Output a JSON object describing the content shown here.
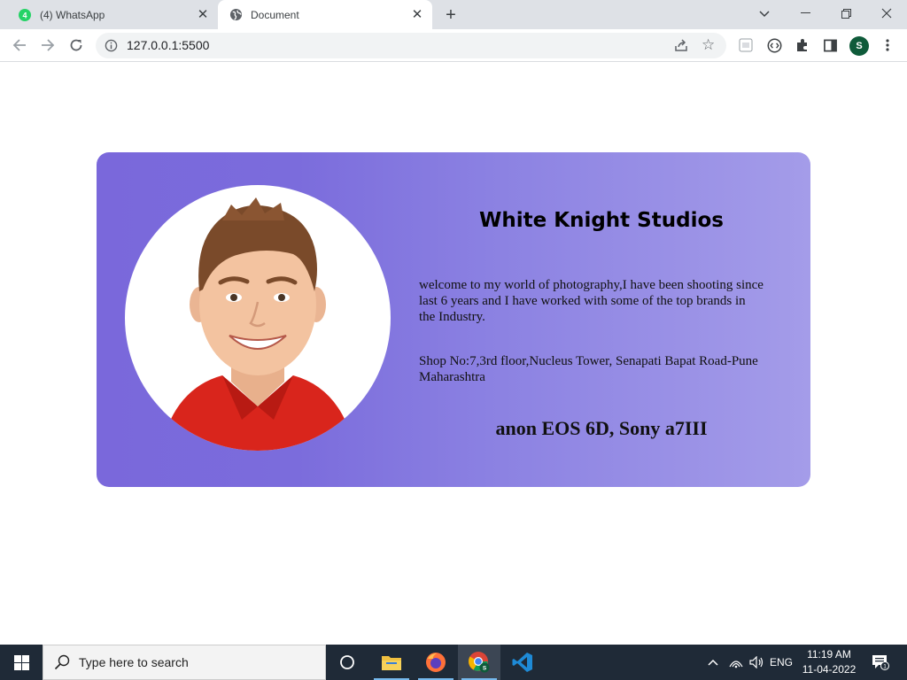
{
  "browser": {
    "tabs": [
      {
        "title": "(4) WhatsApp",
        "icon": "whatsapp-icon",
        "badge": "4",
        "active": false
      },
      {
        "title": "Document",
        "icon": "globe-icon",
        "active": true
      }
    ],
    "url": "127.0.0.1:5500",
    "profile_initial": "S"
  },
  "page": {
    "studio_name": "White Knight Studios",
    "description": "welcome to my world of photography,I have been shooting since last 6 years and I have worked with some of the top brands in the Industry.",
    "address": "Shop No:7,3rd floor,Nucleus Tower, Senapati Bapat Road-Pune Maharashtra",
    "gear": "anon EOS 6D, Sony a7III",
    "colors": {
      "card_start": "#7a68db",
      "card_end": "#a49ce9"
    }
  },
  "taskbar": {
    "search_placeholder": "Type here to search",
    "language": "ENG",
    "time": "11:19 AM",
    "date": "11-04-2022",
    "notification_count": "1",
    "apps": [
      "task-view-icon",
      "file-explorer-icon",
      "firefox-icon",
      "chrome-icon",
      "vscode-icon"
    ]
  }
}
